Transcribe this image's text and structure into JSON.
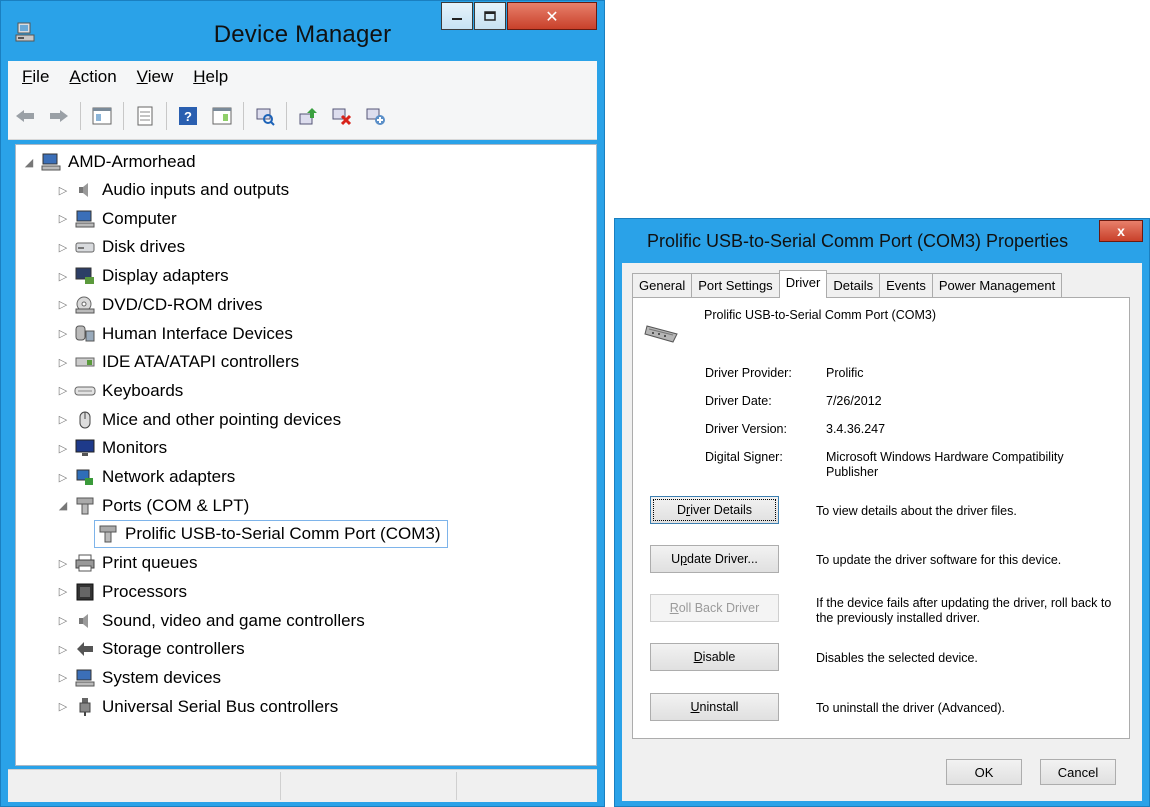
{
  "device_manager": {
    "title": "Device Manager",
    "menu": [
      {
        "id": "file",
        "accel": "F",
        "rest": "ile"
      },
      {
        "id": "action",
        "accel": "A",
        "rest": "ction"
      },
      {
        "id": "view",
        "accel": "V",
        "rest": "iew"
      },
      {
        "id": "help",
        "accel": "H",
        "rest": "elp"
      }
    ],
    "toolbar_icons": [
      "back-icon",
      "forward-icon",
      "properties-icon",
      "show-hide-console-tree-icon",
      "help-icon",
      "show-action-pane-icon",
      "scan-hardware-icon",
      "update-driver-icon",
      "disable-device-icon",
      "uninstall-device-icon"
    ],
    "root": "AMD-Armorhead",
    "categories": [
      "Audio inputs and outputs",
      "Computer",
      "Disk drives",
      "Display adapters",
      "DVD/CD-ROM drives",
      "Human Interface Devices",
      "IDE ATA/ATAPI controllers",
      "Keyboards",
      "Mice and other pointing devices",
      "Monitors",
      "Network adapters",
      "Ports (COM & LPT)",
      "Prolific USB-to-Serial Comm Port (COM3)",
      "Print queues",
      "Processors",
      "Sound, video and game controllers",
      "Storage controllers",
      "System devices",
      "Universal Serial Bus controllers"
    ]
  },
  "properties": {
    "title": "Prolific USB-to-Serial Comm Port (COM3) Properties",
    "close_label": "x",
    "tabs": [
      "General",
      "Port Settings",
      "Driver",
      "Details",
      "Events",
      "Power Management"
    ],
    "active_tab": "Driver",
    "device_name": "Prolific USB-to-Serial Comm Port (COM3)",
    "fields": [
      {
        "label": "Driver Provider:",
        "value": "Prolific"
      },
      {
        "label": "Driver Date:",
        "value": "7/26/2012"
      },
      {
        "label": "Driver Version:",
        "value": "3.4.36.247"
      },
      {
        "label": "Digital Signer:",
        "value": "Microsoft Windows Hardware Compatibility Publisher"
      }
    ],
    "buttons": [
      {
        "accel": "r",
        "pre": "D",
        "post": "iver Details",
        "desc": "To view details about the driver files."
      },
      {
        "accel": "p",
        "pre": "U",
        "post": "date Driver...",
        "desc": "To update the driver software for this device."
      },
      {
        "accel": "R",
        "pre": "",
        "post": "oll Back Driver",
        "desc": "If the device fails after updating the driver, roll back to the previously installed driver."
      },
      {
        "accel": "D",
        "pre": "",
        "post": "isable",
        "desc": "Disables the selected device."
      },
      {
        "accel": "U",
        "pre": "",
        "post": "ninstall",
        "desc": "To uninstall the driver (Advanced)."
      }
    ],
    "ok_label": "OK",
    "cancel_label": "Cancel"
  }
}
